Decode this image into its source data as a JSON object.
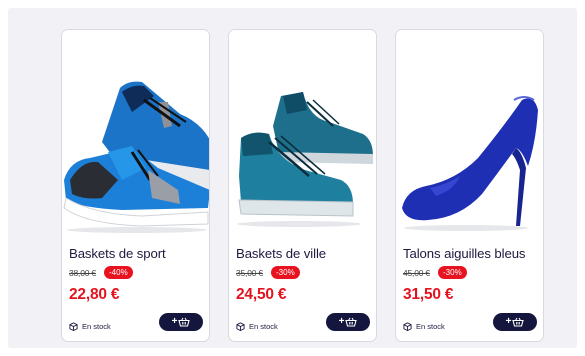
{
  "products": [
    {
      "image": "blue-running-sneakers",
      "title": "Baskets de sport",
      "old_price": "38,00 €",
      "discount": "-40%",
      "price": "22,80 €",
      "stock": "En stock",
      "cart_icon": "plus-basket-icon"
    },
    {
      "image": "teal-high-top-sneakers",
      "title": "Baskets de ville",
      "old_price": "35,00 €",
      "discount": "-30%",
      "price": "24,50 €",
      "stock": "En stock",
      "cart_icon": "plus-basket-icon"
    },
    {
      "image": "blue-stiletto-heel",
      "title": "Talons aiguilles bleus",
      "old_price": "45,00 €",
      "discount": "-30%",
      "price": "31,50 €",
      "stock": "En stock",
      "cart_icon": "plus-basket-icon"
    }
  ],
  "colors": {
    "page_bg": "#f2f2f6",
    "card_border": "#d9d9e1",
    "title": "#1d1a3f",
    "price": "#e31420",
    "badge": "#e8131f",
    "cart_button": "#14163d"
  }
}
